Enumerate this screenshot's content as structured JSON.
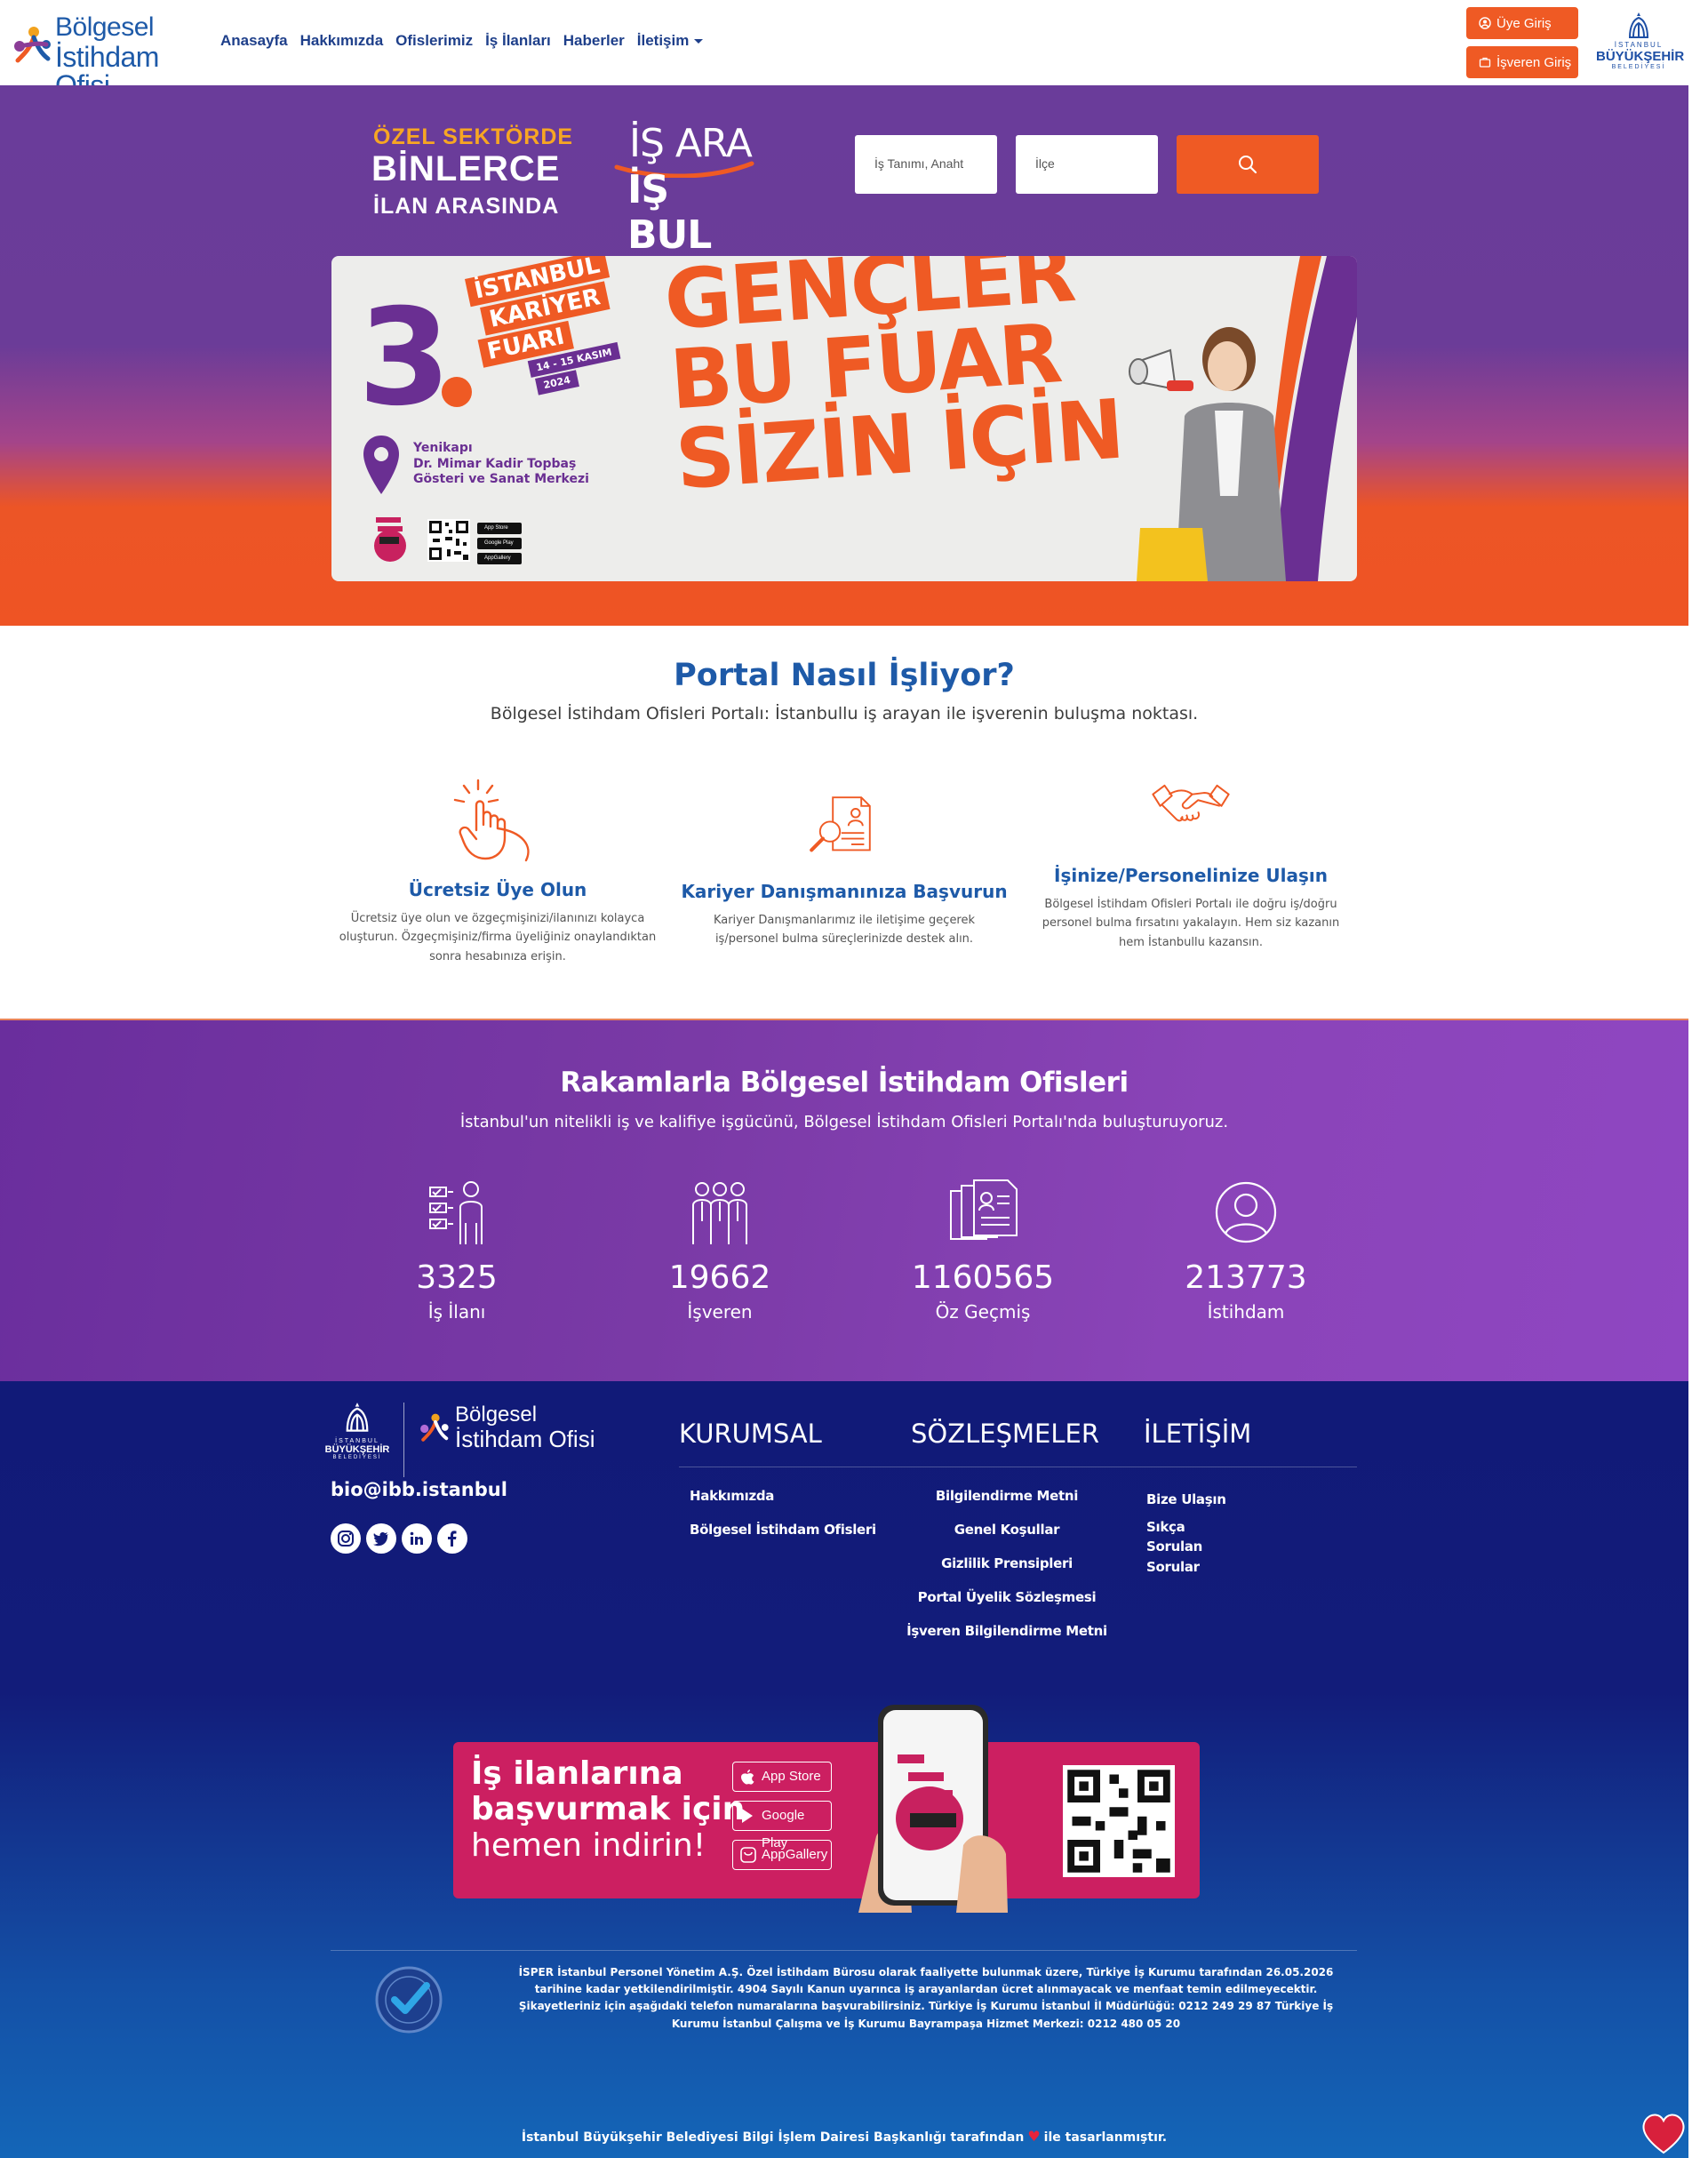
{
  "header": {
    "logo_line1": "Bölgesel",
    "logo_line2": "İstihdam Ofisi",
    "nav": [
      {
        "label": "Anasayfa"
      },
      {
        "label": "Hakkımızda"
      },
      {
        "label": "Ofislerimiz"
      },
      {
        "label": "İş İlanları"
      },
      {
        "label": "Haberler"
      },
      {
        "label": "İletişim"
      }
    ],
    "member_login": "Üye Giriş",
    "employer_login": "İşveren Giriş",
    "ibb_line1": "İSTANBUL",
    "ibb_line2": "BÜYÜKŞEHİR",
    "ibb_line3": "BELEDİYESİ"
  },
  "hero": {
    "tagline1": "ÖZEL SEKTÖRDE",
    "tagline2": "BİNLERCE",
    "tagline3": "İLAN ARASINDA",
    "brand1": "İŞ ARA",
    "brand2": "İŞ BUL",
    "search_placeholder": "İş Tanımı, Anaht",
    "district_placeholder": "İlçe",
    "search_icon": "search-icon"
  },
  "banner": {
    "number": "3",
    "fair_line1": "İSTANBUL",
    "fair_line2": "KARİYER",
    "fair_line3": "FUARI",
    "fair_dates": "14 - 15 KASIM",
    "fair_year": "2024",
    "venue_line1": "Yenikapı",
    "venue_line2": "Dr. Mimar Kadir Topbaş",
    "venue_line3": "Gösteri ve Sanat Merkezi",
    "headline1": "GENÇLER",
    "headline2": "BU FUAR",
    "headline3": "SİZİN İÇİN",
    "store1": "App Store",
    "store2": "Google Play",
    "store3": "AppGallery"
  },
  "portal": {
    "title": "Portal Nasıl İşliyor?",
    "subtitle": "Bölgesel İstihdam Ofisleri Portalı: İstanbullu iş arayan ile işverenin buluşma noktası.",
    "steps": [
      {
        "title": "Ücretsiz Üye Olun",
        "icon": "click-hand-icon",
        "desc": "Ücretsiz üye olun ve özgeçmişinizi/ilanınızı kolayca oluşturun. Özgeçmişiniz/firma üyeliğiniz onaylandıktan sonra hesabınıza erişin."
      },
      {
        "title": "Kariyer Danışmanınıza Başvurun",
        "icon": "resume-search-icon",
        "desc": "Kariyer Danışmanlarımız ile iletişime geçerek iş/personel bulma süreçlerinizde destek alın."
      },
      {
        "title": "İşinize/Personelinize Ulaşın",
        "icon": "handshake-icon",
        "desc": "Bölgesel İstihdam Ofisleri Portalı ile doğru iş/doğru personel bulma fırsatını yakalayın. Hem siz kazanın hem İstanbullu kazansın."
      }
    ]
  },
  "stats": {
    "title": "Rakamlarla Bölgesel İstihdam Ofisleri",
    "subtitle": "İstanbul'un nitelikli iş ve kalifiye işgücünü, Bölgesel İstihdam Ofisleri Portalı'nda buluşturuyoruz.",
    "items": [
      {
        "value": "3325",
        "label": "İş İlanı",
        "icon": "checklist-person-icon"
      },
      {
        "value": "19662",
        "label": "İşveren",
        "icon": "group-icon"
      },
      {
        "value": "1160565",
        "label": "Öz Geçmiş",
        "icon": "documents-icon"
      },
      {
        "value": "213773",
        "label": "İstihdam",
        "icon": "user-circle-icon"
      }
    ]
  },
  "footer": {
    "ibb_line1": "İSTANBUL",
    "ibb_line2": "BÜYÜKŞEHİR",
    "ibb_line3": "BELEDİYESİ",
    "logo_line1": "Bölgesel",
    "logo_line2": "İstihdam Ofisi",
    "email": "bio@ibb.istanbul",
    "col1_title": "KURUMSAL",
    "col2_title": "SÖZLEŞMELER",
    "col3_title": "İLETİŞİM",
    "col1_links": [
      "Hakkımızda",
      "Bölgesel İstihdam Ofisleri"
    ],
    "col2_links": [
      "Bilgilendirme Metni",
      "Genel Koşullar",
      "Gizlilik Prensipleri",
      "Portal Üyelik Sözleşmesi",
      "İşveren Bilgilendirme Metni"
    ],
    "col3_links": [
      "Bize Ulaşın",
      "Sıkça Sorulan Sorular"
    ],
    "social": [
      "instagram-icon",
      "twitter-icon",
      "linkedin-icon",
      "facebook-icon"
    ],
    "promo_line1": "İş ilanlarına",
    "promo_line2": "başvurmak için",
    "promo_line3": "hemen indirin!",
    "promo_store1": "App Store",
    "promo_store2": "Google Play",
    "promo_store3": "AppGallery",
    "legal": "İSPER İstanbul Personel Yönetim A.Ş. Özel İstihdam Bürosu olarak faaliyette bulunmak üzere, Türkiye İş Kurumu tarafından 26.05.2026 tarihine kadar yetkilendirilmiştir. 4904 Sayılı Kanun uyarınca iş arayanlardan ücret alınmayacak ve menfaat temin edilmeyecektir. Şikayetleriniz için aşağıdaki telefon numaralarına başvurabilirsiniz. Türkiye İş Kurumu İstanbul İl Müdürlüğü: 0212 249 29 87 Türkiye İş Kurumu İstanbul Çalışma ve İş Kurumu Bayrampaşa Hizmet Merkezi: 0212 480 05 20",
    "credit_pre": "İstanbul Büyükşehir Belediyesi Bilgi İşlem Dairesi Başkanlığı tarafından",
    "credit_post": "ile tasarlanmıştır."
  },
  "colors": {
    "brand_blue": "#1e5aa8",
    "accent_orange": "#ef5a24",
    "purple": "#6a3c9a",
    "footer_navy": "#121c7a",
    "promo_pink": "#cc1f61"
  }
}
